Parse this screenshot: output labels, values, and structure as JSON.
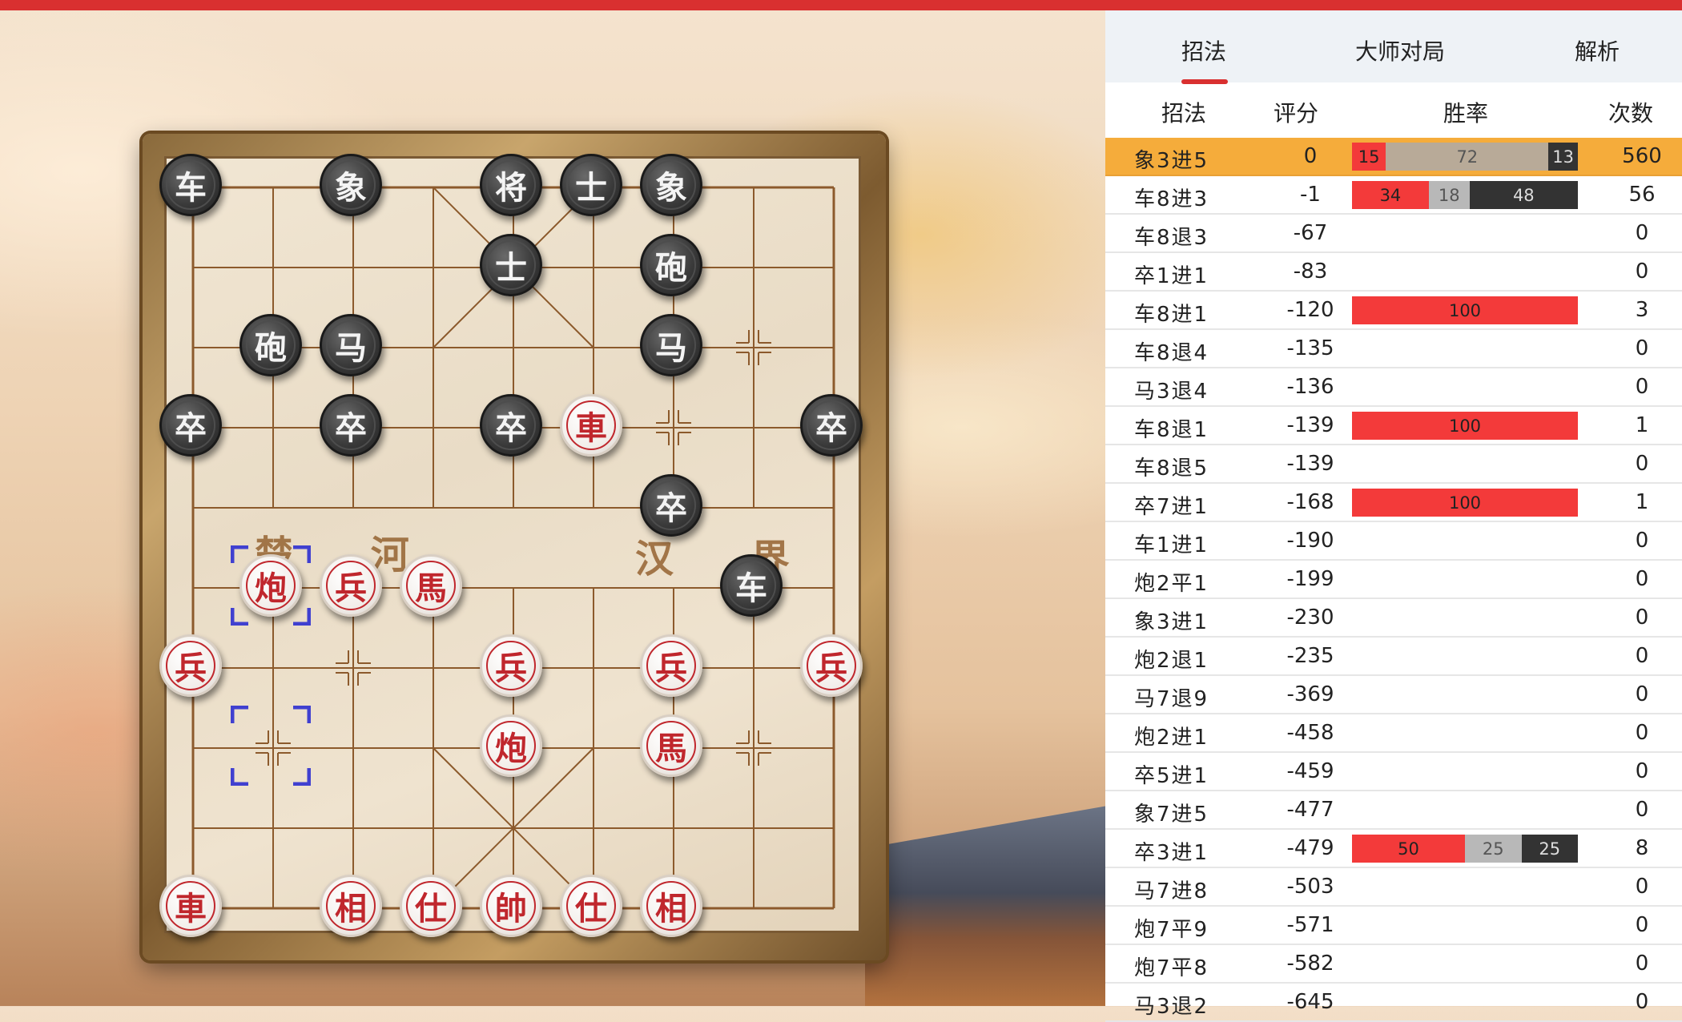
{
  "tabs": [
    {
      "label": "招法",
      "active": true
    },
    {
      "label": "大师对局",
      "active": false
    },
    {
      "label": "解析",
      "active": false
    }
  ],
  "columns": {
    "move": "招法",
    "score": "评分",
    "winrate": "胜率",
    "count": "次数"
  },
  "moves": [
    {
      "move": "象3进5",
      "score": "0",
      "bar": [
        15,
        72,
        13
      ],
      "count": "560",
      "selected": true
    },
    {
      "move": "车8进3",
      "score": "-1",
      "bar": [
        34,
        18,
        48
      ],
      "count": "56"
    },
    {
      "move": "车8退3",
      "score": "-67",
      "bar": null,
      "count": "0"
    },
    {
      "move": "卒1进1",
      "score": "-83",
      "bar": null,
      "count": "0"
    },
    {
      "move": "车8进1",
      "score": "-120",
      "bar": [
        100,
        0,
        0
      ],
      "count": "3"
    },
    {
      "move": "车8退4",
      "score": "-135",
      "bar": null,
      "count": "0"
    },
    {
      "move": "马3退4",
      "score": "-136",
      "bar": null,
      "count": "0"
    },
    {
      "move": "车8退1",
      "score": "-139",
      "bar": [
        100,
        0,
        0
      ],
      "count": "1"
    },
    {
      "move": "车8退5",
      "score": "-139",
      "bar": null,
      "count": "0"
    },
    {
      "move": "卒7进1",
      "score": "-168",
      "bar": [
        100,
        0,
        0
      ],
      "count": "1"
    },
    {
      "move": "车1进1",
      "score": "-190",
      "bar": null,
      "count": "0"
    },
    {
      "move": "炮2平1",
      "score": "-199",
      "bar": null,
      "count": "0"
    },
    {
      "move": "象3进1",
      "score": "-230",
      "bar": null,
      "count": "0"
    },
    {
      "move": "炮2退1",
      "score": "-235",
      "bar": null,
      "count": "0"
    },
    {
      "move": "马7退9",
      "score": "-369",
      "bar": null,
      "count": "0"
    },
    {
      "move": "炮2进1",
      "score": "-458",
      "bar": null,
      "count": "0"
    },
    {
      "move": "卒5进1",
      "score": "-459",
      "bar": null,
      "count": "0"
    },
    {
      "move": "象7进5",
      "score": "-477",
      "bar": null,
      "count": "0"
    },
    {
      "move": "卒3进1",
      "score": "-479",
      "bar": [
        50,
        25,
        25
      ],
      "count": "8"
    },
    {
      "move": "马7进8",
      "score": "-503",
      "bar": null,
      "count": "0"
    },
    {
      "move": "炮7平9",
      "score": "-571",
      "bar": null,
      "count": "0"
    },
    {
      "move": "炮7平8",
      "score": "-582",
      "bar": null,
      "count": "0"
    },
    {
      "move": "马3退2",
      "score": "-645",
      "bar": null,
      "count": "0"
    }
  ],
  "board": {
    "river_left": "楚 河",
    "river_right": "汉 界",
    "pieces": [
      {
        "ch": "车",
        "side": "black",
        "file": 0,
        "rank": 0
      },
      {
        "ch": "象",
        "side": "black",
        "file": 2,
        "rank": 0
      },
      {
        "ch": "将",
        "side": "black",
        "file": 4,
        "rank": 0
      },
      {
        "ch": "士",
        "side": "black",
        "file": 5,
        "rank": 0
      },
      {
        "ch": "象",
        "side": "black",
        "file": 6,
        "rank": 0
      },
      {
        "ch": "士",
        "side": "black",
        "file": 4,
        "rank": 1
      },
      {
        "ch": "砲",
        "side": "black",
        "file": 6,
        "rank": 1
      },
      {
        "ch": "砲",
        "side": "black",
        "file": 1,
        "rank": 2
      },
      {
        "ch": "马",
        "side": "black",
        "file": 2,
        "rank": 2
      },
      {
        "ch": "马",
        "side": "black",
        "file": 6,
        "rank": 2
      },
      {
        "ch": "卒",
        "side": "black",
        "file": 0,
        "rank": 3
      },
      {
        "ch": "卒",
        "side": "black",
        "file": 2,
        "rank": 3
      },
      {
        "ch": "卒",
        "side": "black",
        "file": 4,
        "rank": 3
      },
      {
        "ch": "卒",
        "side": "black",
        "file": 8,
        "rank": 3
      },
      {
        "ch": "卒",
        "side": "black",
        "file": 6,
        "rank": 4
      },
      {
        "ch": "车",
        "side": "black",
        "file": 7,
        "rank": 5
      },
      {
        "ch": "車",
        "side": "red",
        "file": 5,
        "rank": 3
      },
      {
        "ch": "炮",
        "side": "red",
        "file": 1,
        "rank": 5
      },
      {
        "ch": "兵",
        "side": "red",
        "file": 2,
        "rank": 5
      },
      {
        "ch": "馬",
        "side": "red",
        "file": 3,
        "rank": 5
      },
      {
        "ch": "兵",
        "side": "red",
        "file": 0,
        "rank": 6
      },
      {
        "ch": "兵",
        "side": "red",
        "file": 4,
        "rank": 6
      },
      {
        "ch": "兵",
        "side": "red",
        "file": 6,
        "rank": 6
      },
      {
        "ch": "兵",
        "side": "red",
        "file": 8,
        "rank": 6
      },
      {
        "ch": "炮",
        "side": "red",
        "file": 4,
        "rank": 7
      },
      {
        "ch": "馬",
        "side": "red",
        "file": 6,
        "rank": 7
      },
      {
        "ch": "車",
        "side": "red",
        "file": 0,
        "rank": 9
      },
      {
        "ch": "相",
        "side": "red",
        "file": 2,
        "rank": 9
      },
      {
        "ch": "仕",
        "side": "red",
        "file": 3,
        "rank": 9
      },
      {
        "ch": "帥",
        "side": "red",
        "file": 4,
        "rank": 9
      },
      {
        "ch": "仕",
        "side": "red",
        "file": 5,
        "rank": 9
      },
      {
        "ch": "相",
        "side": "red",
        "file": 6,
        "rank": 9
      }
    ],
    "last_move_from": {
      "file": 1,
      "rank": 7
    },
    "last_move_to": {
      "file": 1,
      "rank": 5
    }
  },
  "colors": {
    "accent": "#d93030",
    "selected_row": "#f5ac3b",
    "win_red": "#f33a3a",
    "draw_gray": "#b8b8b8",
    "loss_black": "#333333",
    "marker_blue": "#4040d0"
  }
}
